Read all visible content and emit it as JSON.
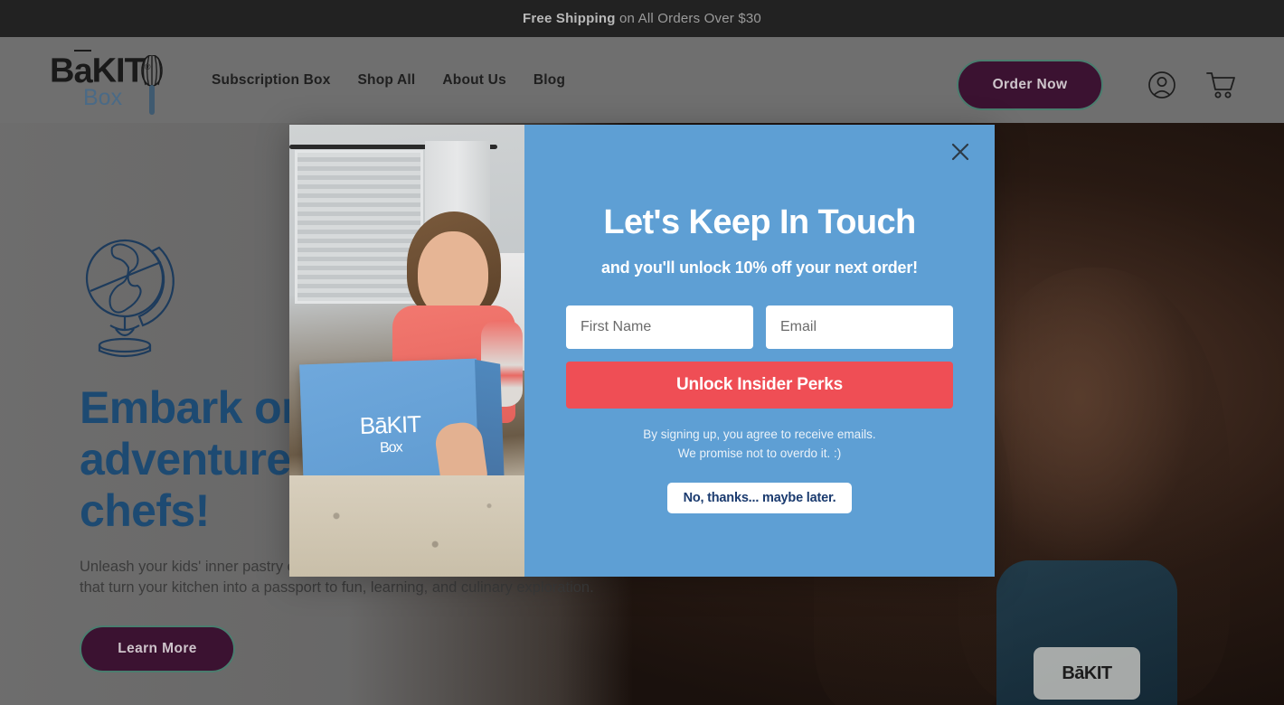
{
  "announcement": {
    "bold_text": "Free Shipping",
    "rest_text": " on All Orders Over $30"
  },
  "header": {
    "logo": {
      "main": "B",
      "macron_letter": "a",
      "main_rest": "KIT",
      "registered": "®",
      "sub": "Box",
      "whisk_icon": "whisk-icon"
    },
    "nav": [
      {
        "label": "Subscription Box"
      },
      {
        "label": "Shop All"
      },
      {
        "label": "About Us"
      },
      {
        "label": "Blog"
      }
    ],
    "order_button": "Order Now",
    "account_icon": "user-account-icon",
    "cart_icon": "shopping-cart-icon"
  },
  "hero": {
    "globe_icon": "globe-icon",
    "title": "Embark on a baking adventure with your little chefs!",
    "paragraph": "Unleash your kids' inner pastry chef with hands-on kits and globally inspired recipes that turn your kitchen into a passport to fun, learning, and culinary exploration.",
    "cta": "Learn More",
    "apron_logo": "BāKIT"
  },
  "modal": {
    "close_icon": "close-icon",
    "image_alt": "girl-holding-bakit-box-photo",
    "image_box_logo": "BāKIT",
    "image_box_logo_sub": "Box",
    "title": "Let's Keep In Touch",
    "subtitle": "and you'll unlock 10% off your next order!",
    "first_name_placeholder": "First Name",
    "first_name_value": "",
    "email_placeholder": "Email",
    "email_value": "",
    "submit_label": "Unlock Insider Perks",
    "disclaimer_line1": "By signing up, you agree to receive emails.",
    "disclaimer_line2": "We promise not to overdo it. :)",
    "decline_label": "No, thanks... maybe later."
  },
  "colors": {
    "announcement_bg": "#222222",
    "header_bg": "#6f6f6f",
    "modal_blue": "#5e9fd4",
    "submit_red": "#ef4e55",
    "button_purple": "#3b1231",
    "button_border_teal": "#4a7d6e",
    "hero_title_navy": "#1d4a72",
    "decline_text_navy": "#1b3b6f"
  }
}
